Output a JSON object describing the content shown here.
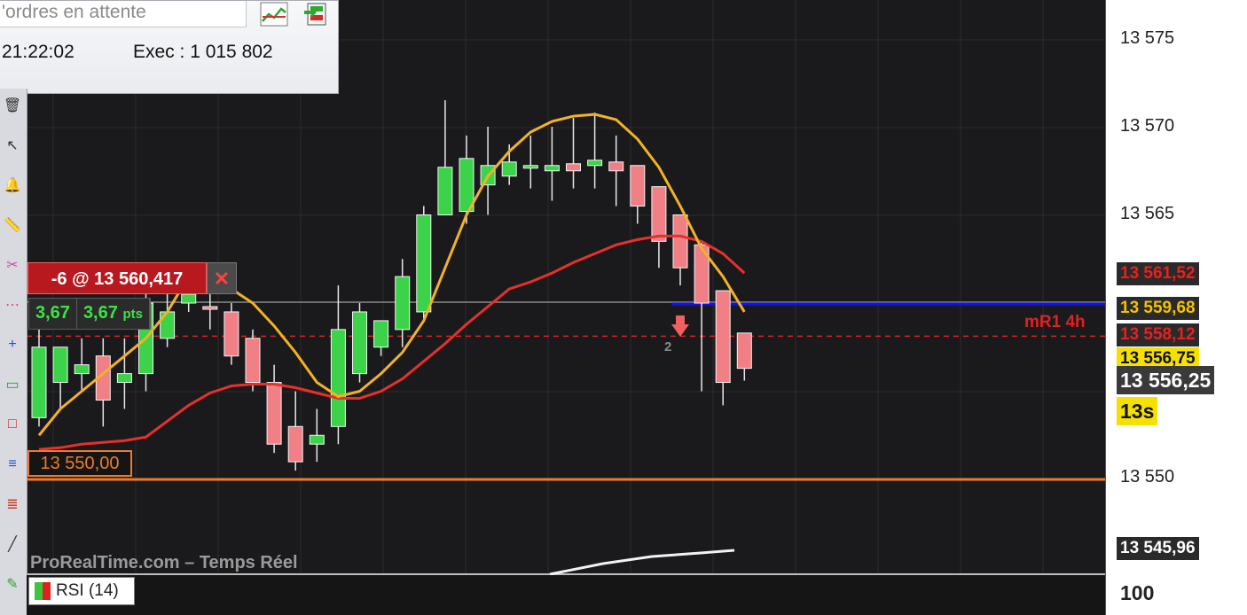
{
  "order_panel": {
    "search_placeholder": "'ordres en attente",
    "time": "21:22:02",
    "exec": "Exec : 1 015 802"
  },
  "position": {
    "label": "-6 @ 13 560,417",
    "close_symbol": "✕",
    "pnl_points": "3,67",
    "pnl_value": "3,67",
    "pnl_unit": "pts"
  },
  "take_profit_label": "13 550,00",
  "pivot_label": "mR1 4h",
  "signal_count": "2",
  "watermark": "ProRealTime.com – Temps Réel",
  "rsi_legend": "RSI (14)",
  "axis": {
    "ticks": [
      "13 575",
      "13 570",
      "13 565",
      "13 550"
    ],
    "rsi_tick": "100"
  },
  "price_tags": [
    {
      "text": "13 561,52",
      "color": "#e82020",
      "bg": "#2a2a2a"
    },
    {
      "text": "13 559,68",
      "color": "#f2c200",
      "bg": "#2a2a2a"
    },
    {
      "text": "13 558,12",
      "color": "#e82020",
      "bg": "#2a2a2a"
    },
    {
      "text": "13 556,75",
      "color": "#111111",
      "bg": "#f6e000"
    },
    {
      "text": "13 556,25",
      "color": "#ffffff",
      "bg": "#3a3a3a"
    },
    {
      "text": "13s",
      "color": "#111111",
      "bg": "#f6e000"
    },
    {
      "text": "13 545,96",
      "color": "#ffffff",
      "bg": "#2a2a2a"
    }
  ],
  "colors": {
    "up": "#3cd24a",
    "down": "#f07f86",
    "ma_fast": "#f2b227",
    "ma_slow": "#e8302a",
    "resistance": "#1212f2",
    "take_profit": "#f07a28"
  },
  "toolbar_icons": [
    "trash-icon",
    "cursor-icon",
    "alert-bell-icon",
    "ruler-icon",
    "scissors-icon",
    "dots-icon",
    "crosshair-icon",
    "rectangle-icon",
    "square-icon",
    "text-tool-icon",
    "fibonacci-icon",
    "line-tool-icon",
    "pencil-icon"
  ],
  "chart_data": {
    "type": "candlestick",
    "ylim": [
      13545,
      13577
    ],
    "candles": [
      {
        "o": 13553.5,
        "h": 13558.5,
        "l": 13553,
        "c": 13557.5
      },
      {
        "o": 13555.5,
        "h": 13557,
        "l": 13554,
        "c": 13557.5
      },
      {
        "o": 13556,
        "h": 13558,
        "l": 13555,
        "c": 13556.5
      },
      {
        "o": 13557,
        "h": 13558,
        "l": 13553,
        "c": 13554.5
      },
      {
        "o": 13555.5,
        "h": 13558,
        "l": 13554,
        "c": 13556
      },
      {
        "o": 13556,
        "h": 13560.5,
        "l": 13555,
        "c": 13560
      },
      {
        "o": 13558,
        "h": 13561,
        "l": 13557.5,
        "c": 13559.5
      },
      {
        "o": 13560,
        "h": 13561,
        "l": 13559.5,
        "c": 13560.5
      },
      {
        "o": 13559.8,
        "h": 13560.5,
        "l": 13558.5,
        "c": 13559.7
      },
      {
        "o": 13559.5,
        "h": 13560,
        "l": 13556.5,
        "c": 13557
      },
      {
        "o": 13558,
        "h": 13558.5,
        "l": 13555,
        "c": 13555.5
      },
      {
        "o": 13555.5,
        "h": 13556.5,
        "l": 13551.5,
        "c": 13552
      },
      {
        "o": 13553,
        "h": 13555,
        "l": 13550.5,
        "c": 13551
      },
      {
        "o": 13552,
        "h": 13554,
        "l": 13551,
        "c": 13552.5
      },
      {
        "o": 13553,
        "h": 13561,
        "l": 13552,
        "c": 13558.5
      },
      {
        "o": 13556,
        "h": 13560,
        "l": 13555.5,
        "c": 13559.5
      },
      {
        "o": 13557.5,
        "h": 13559,
        "l": 13557,
        "c": 13559
      },
      {
        "o": 13558.5,
        "h": 13562.5,
        "l": 13557.5,
        "c": 13561.5
      },
      {
        "o": 13559.5,
        "h": 13565.5,
        "l": 13559,
        "c": 13565
      },
      {
        "o": 13565,
        "h": 13571.5,
        "l": 13565,
        "c": 13567.7
      },
      {
        "o": 13565.2,
        "h": 13569.5,
        "l": 13564.5,
        "c": 13568.2
      },
      {
        "o": 13566.7,
        "h": 13570,
        "l": 13565,
        "c": 13567.8
      },
      {
        "o": 13567.2,
        "h": 13569,
        "l": 13566.7,
        "c": 13568
      },
      {
        "o": 13567.8,
        "h": 13569.5,
        "l": 13566.5,
        "c": 13567.8
      },
      {
        "o": 13567.5,
        "h": 13570,
        "l": 13565.8,
        "c": 13567.8
      },
      {
        "o": 13567.9,
        "h": 13570.5,
        "l": 13566.5,
        "c": 13567.5
      },
      {
        "o": 13567.8,
        "h": 13570.8,
        "l": 13566.5,
        "c": 13568.1
      },
      {
        "o": 13568,
        "h": 13569.5,
        "l": 13565.5,
        "c": 13567.5
      },
      {
        "o": 13567.8,
        "h": 13567.8,
        "l": 13564.5,
        "c": 13565.5
      },
      {
        "o": 13566.6,
        "h": 13566.6,
        "l": 13562,
        "c": 13563.5
      },
      {
        "o": 13565,
        "h": 13565,
        "l": 13561,
        "c": 13562
      },
      {
        "o": 13563.3,
        "h": 13563.5,
        "l": 13555,
        "c": 13560
      },
      {
        "o": 13560.7,
        "h": 13560.7,
        "l": 13554.2,
        "c": 13555.5
      },
      {
        "o": 13558.3,
        "h": 13558.3,
        "l": 13555.6,
        "c": 13556.3
      }
    ],
    "ma_fast_line": [
      13552.5,
      13554,
      13555,
      13556,
      13557,
      13558,
      13559.5,
      13561.5,
      13561.5,
      13560.8,
      13560,
      13558.7,
      13557.2,
      13555.5,
      13554.7,
      13555,
      13556,
      13557.2,
      13559,
      13562,
      13565,
      13567.2,
      13568.6,
      13569.7,
      13570.3,
      13570.6,
      13570.7,
      13570.4,
      13569.3,
      13567.7,
      13565.5,
      13563.1,
      13561.5,
      13559.5
    ],
    "ma_slow_line": [
      13551.7,
      13551.8,
      13552,
      13552.1,
      13552.2,
      13552.4,
      13553.3,
      13554.2,
      13554.9,
      13555.3,
      13555.4,
      13555.4,
      13555.2,
      13554.9,
      13554.6,
      13554.6,
      13555,
      13555.7,
      13556.7,
      13557.7,
      13558.8,
      13559.8,
      13560.8,
      13561.2,
      13561.7,
      13562.3,
      13562.8,
      13563.3,
      13563.6,
      13563.8,
      13563.8,
      13563.5,
      13562.8,
      13561.7
    ],
    "horizontal_lines": {
      "resistance": 13559.95,
      "position": 13560.05,
      "pivot": 13558.12,
      "take_profit": 13550
    },
    "sell_signal_candle": 30
  }
}
